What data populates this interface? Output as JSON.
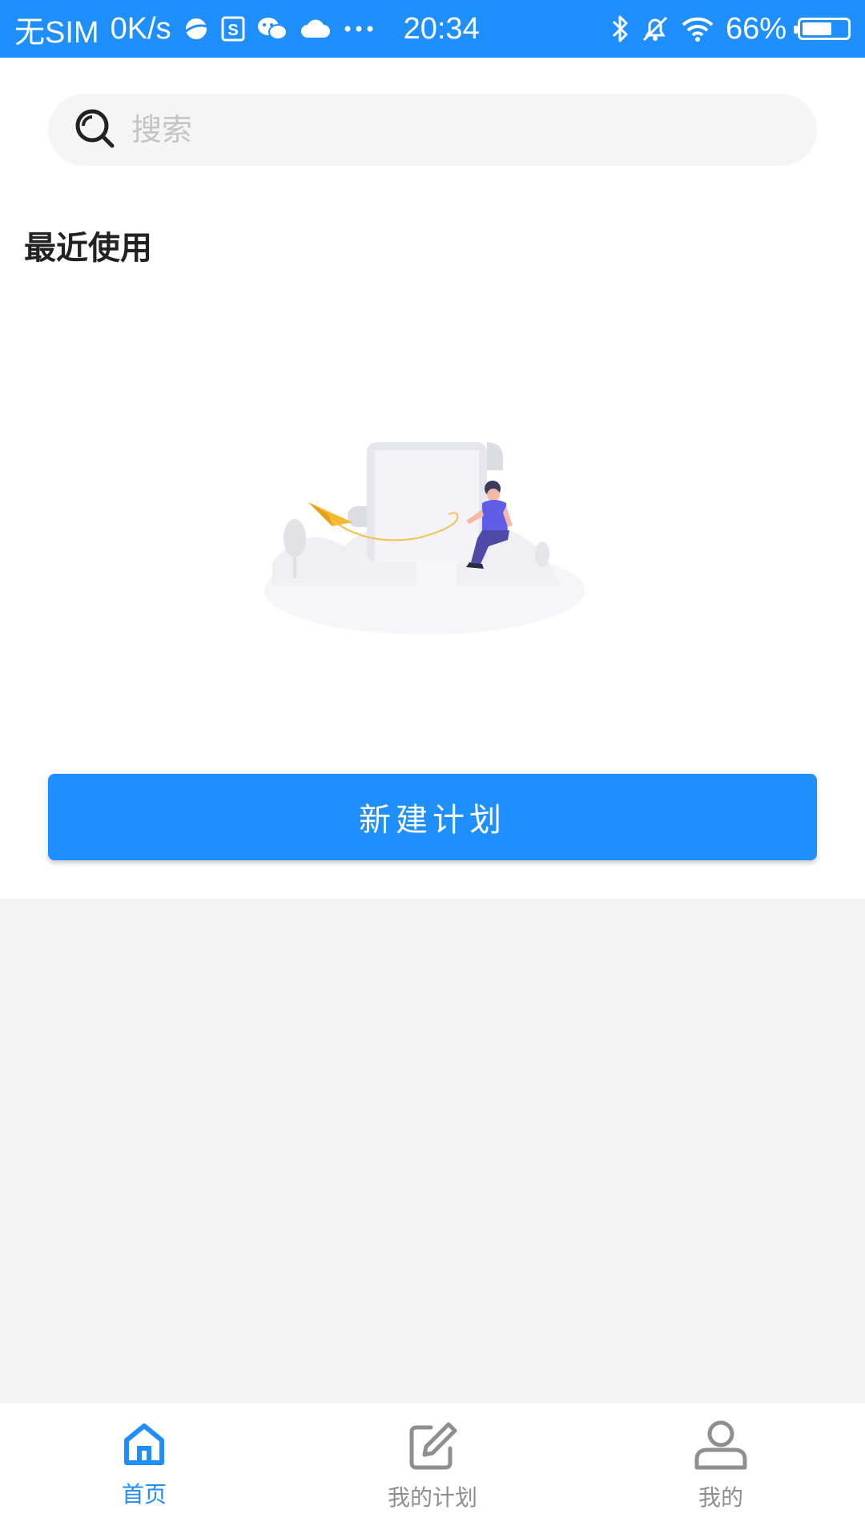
{
  "statusbar": {
    "carrier": "无SIM",
    "speed": "0K/s",
    "time": "20:34",
    "battery": "66%",
    "battery_level": 0.66,
    "icons": [
      "browser-icon",
      "s-app-icon",
      "wechat-icon",
      "cloud-icon",
      "more-dots-icon",
      "bluetooth-icon",
      "bell-off-icon",
      "wifi-icon",
      "battery-icon"
    ]
  },
  "search": {
    "placeholder": "搜索",
    "value": ""
  },
  "recent": {
    "title": "最近使用"
  },
  "actions": {
    "new_plan": "新建计划"
  },
  "nav": {
    "items": [
      {
        "label": "首页",
        "icon": "home-icon",
        "active": true
      },
      {
        "label": "我的计划",
        "icon": "edit-icon",
        "active": false
      },
      {
        "label": "我的",
        "icon": "user-icon",
        "active": false
      }
    ]
  },
  "colors": {
    "primary": "#1e8ffd",
    "inactive": "#8f8f8f",
    "background": "#f3f3f3",
    "surface": "#ffffff"
  }
}
